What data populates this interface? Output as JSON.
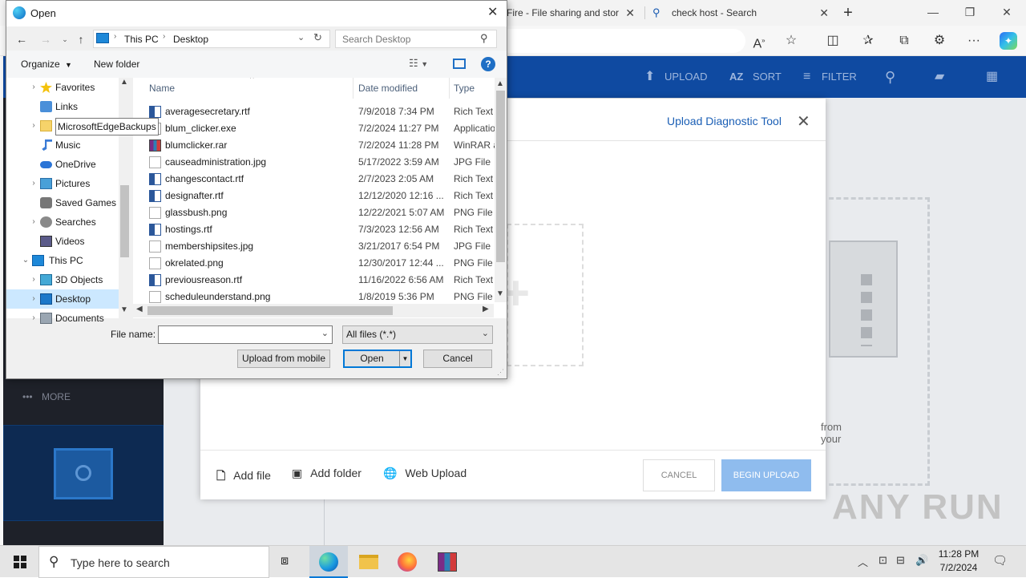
{
  "browser": {
    "tabs": [
      {
        "label": "Fire - File sharing and stor"
      },
      {
        "label": "check host - Search"
      }
    ],
    "new_tab": "+",
    "window": {
      "minimize": "—",
      "restore": "❐",
      "close": "✕"
    }
  },
  "site": {
    "toolbar": {
      "upload": "UPLOAD",
      "sort": "SORT",
      "filter": "FILTER"
    },
    "leftnav": {
      "more": "MORE"
    }
  },
  "modal": {
    "link": "Upload Diagnostic Tool",
    "body_text": "from your",
    "add_file": "Add file",
    "add_folder": "Add folder",
    "web_upload": "Web Upload",
    "cancel": "CANCEL",
    "begin_upload": "BEGIN UPLOAD"
  },
  "dialog": {
    "title": "Open",
    "breadcrumb": [
      "This PC",
      "Desktop"
    ],
    "search_placeholder": "Search Desktop",
    "organize": "Organize",
    "new_folder": "New folder",
    "tree": [
      {
        "label": "Favorites",
        "icon": "star-icon",
        "level": 1,
        "expand": "›"
      },
      {
        "label": "Links",
        "icon": "link-folder-icon",
        "level": 1,
        "expand": ""
      },
      {
        "label": "MicrosoftEdgeBackups",
        "icon": "folder-icon",
        "level": 1,
        "expand": "›"
      },
      {
        "label": "Music",
        "icon": "music-icon",
        "level": 1,
        "expand": ""
      },
      {
        "label": "OneDrive",
        "icon": "cloud-icon",
        "level": 1,
        "expand": ""
      },
      {
        "label": "Pictures",
        "icon": "pictures-icon",
        "level": 1,
        "expand": "›"
      },
      {
        "label": "Saved Games",
        "icon": "saved-games-icon",
        "level": 1,
        "expand": ""
      },
      {
        "label": "Searches",
        "icon": "search-folder-icon",
        "level": 1,
        "expand": "›"
      },
      {
        "label": "Videos",
        "icon": "videos-icon",
        "level": 1,
        "expand": ""
      },
      {
        "label": "This PC",
        "icon": "pc-icon",
        "level": 0,
        "expand": "⌄"
      },
      {
        "label": "3D Objects",
        "icon": "cube-icon",
        "level": 1,
        "expand": "›"
      },
      {
        "label": "Desktop",
        "icon": "desktop-icon",
        "level": 1,
        "expand": "›"
      },
      {
        "label": "Documents",
        "icon": "documents-icon",
        "level": 1,
        "expand": "›"
      }
    ],
    "columns": {
      "name": "Name",
      "date": "Date modified",
      "type": "Type"
    },
    "files": [
      {
        "name": "averagesecretary.rtf",
        "date": "7/9/2018 7:34 PM",
        "type": "Rich Text",
        "icon": "rtf-icon"
      },
      {
        "name": "blum_clicker.exe",
        "date": "7/2/2024 11:27 PM",
        "type": "Application",
        "icon": "exe-icon"
      },
      {
        "name": "blumclicker.rar",
        "date": "7/2/2024 11:28 PM",
        "type": "WinRAR archive",
        "icon": "rar-icon"
      },
      {
        "name": "causeadministration.jpg",
        "date": "5/17/2022 3:59 AM",
        "type": "JPG File",
        "icon": "image-icon"
      },
      {
        "name": "changescontact.rtf",
        "date": "2/7/2023 2:05 AM",
        "type": "Rich Text",
        "icon": "rtf-icon"
      },
      {
        "name": "designafter.rtf",
        "date": "12/12/2020 12:16 ...",
        "type": "Rich Text",
        "icon": "rtf-icon"
      },
      {
        "name": "glassbush.png",
        "date": "12/22/2021 5:07 AM",
        "type": "PNG File",
        "icon": "image-icon"
      },
      {
        "name": "hostings.rtf",
        "date": "7/3/2023 12:56 AM",
        "type": "Rich Text",
        "icon": "rtf-icon"
      },
      {
        "name": "membershipsites.jpg",
        "date": "3/21/2017 6:54 PM",
        "type": "JPG File",
        "icon": "image-icon"
      },
      {
        "name": "okrelated.png",
        "date": "12/30/2017 12:44 ...",
        "type": "PNG File",
        "icon": "image-icon"
      },
      {
        "name": "previousreason.rtf",
        "date": "11/16/2022 6:56 AM",
        "type": "Rich Text",
        "icon": "rtf-icon"
      },
      {
        "name": "scheduleunderstand.png",
        "date": "1/8/2019 5:36 PM",
        "type": "PNG File",
        "icon": "image-icon"
      }
    ],
    "file_name_label": "File name:",
    "file_name_value": "",
    "filter": "All files (*.*)",
    "upload_mobile": "Upload from mobile",
    "open": "Open",
    "cancel": "Cancel"
  },
  "taskbar": {
    "search_placeholder": "Type here to search",
    "time": "11:28 PM",
    "date": "7/2/2024"
  },
  "watermark": "ANY RUN"
}
